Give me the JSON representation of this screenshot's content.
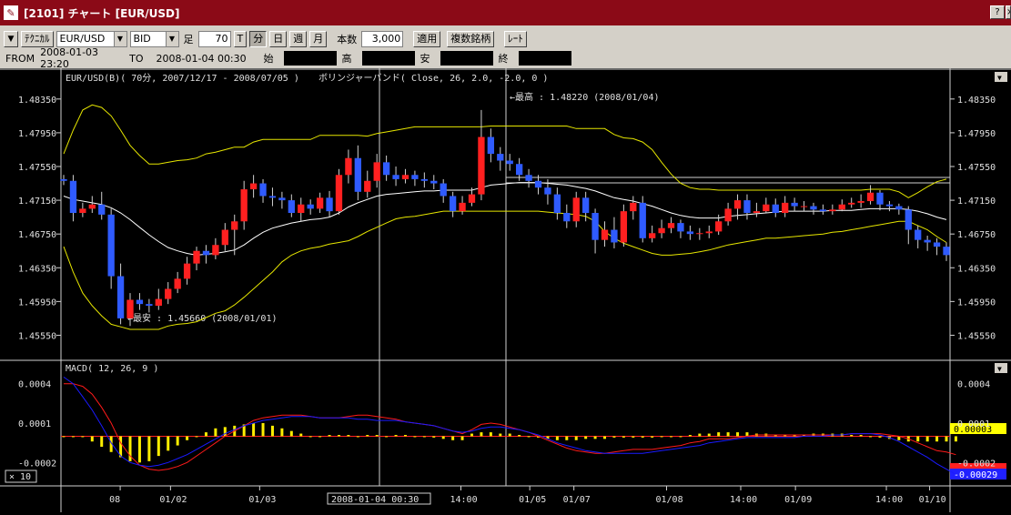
{
  "window": {
    "title": "[2101] チャート [EUR/USD]",
    "help_label": "?",
    "close_label": "×"
  },
  "toolbar": {
    "menu_arrow": "▼",
    "technical_label": "ﾃｸﾆｶﾙ",
    "pair_value": "EUR/USD",
    "side_value": "BID",
    "bar_label": "足",
    "bar_value": "70",
    "period_buttons": [
      "T",
      "分",
      "日",
      "週",
      "月"
    ],
    "count_label": "本数",
    "count_value": "3,000",
    "apply_label": "適用",
    "multi_label": "複数銘柄",
    "rate_label": "ﾚｰﾄ"
  },
  "info": {
    "from_label": "FROM",
    "from_value": "2008-01-03  23:20",
    "to_label": "TO",
    "to_value": "2008-01-04  00:30",
    "open_label": "始",
    "high_label": "高",
    "low_label": "安",
    "close_label": "終"
  },
  "colors": {
    "up": "#ff2020",
    "down": "#2f5bff",
    "band": "#e6e600",
    "mid": "#ffffff",
    "macd": "#1a1aff",
    "signal": "#ff1a1a",
    "hist": "#ffee00",
    "grid": "#d0d0d0"
  },
  "chart_data": [
    {
      "type": "candlestick",
      "title": "EUR/USD(B)( 70分, 2007/12/17 - 2008/07/05 )",
      "indicator": "ボリンジャーバンド( Close, 26, 2.0, -2.0, 0 )",
      "ylim": [
        1.4535,
        1.4865
      ],
      "yticks": [
        "1.48350",
        "1.47950",
        "1.47550",
        "1.47150",
        "1.46750",
        "1.46350",
        "1.45950",
        "1.45550"
      ],
      "xticks": [
        "08",
        "01/02",
        "01/03",
        "14:00",
        "01/05",
        "01/07",
        "01/08",
        "14:00",
        "01/09",
        "14:00",
        "01/10"
      ],
      "cursor_label": "2008-01-04  00:30",
      "high_annotation": "←最高 : 1.48220 (2008/01/04)",
      "low_annotation": "←最安 : 1.45660 (2008/01/01)",
      "candles": [
        [
          1.474,
          1.4738,
          1.4745,
          1.4733
        ],
        [
          1.4738,
          1.47,
          1.4745,
          1.469
        ],
        [
          1.47,
          1.4705,
          1.4712,
          1.4695
        ],
        [
          1.4705,
          1.471,
          1.472,
          1.47
        ],
        [
          1.471,
          1.4698,
          1.4725,
          1.4692
        ],
        [
          1.4698,
          1.4625,
          1.4705,
          1.461
        ],
        [
          1.4625,
          1.4575,
          1.464,
          1.4568
        ],
        [
          1.4575,
          1.4597,
          1.4605,
          1.4566
        ],
        [
          1.4597,
          1.4592,
          1.4605,
          1.4585
        ],
        [
          1.4592,
          1.459,
          1.4598,
          1.4582
        ],
        [
          1.459,
          1.4598,
          1.461,
          1.4585
        ],
        [
          1.4598,
          1.461,
          1.4618,
          1.4592
        ],
        [
          1.461,
          1.4622,
          1.463,
          1.4605
        ],
        [
          1.4622,
          1.464,
          1.4648,
          1.4615
        ],
        [
          1.464,
          1.4655,
          1.466,
          1.4632
        ],
        [
          1.4655,
          1.465,
          1.4662,
          1.464
        ],
        [
          1.465,
          1.4662,
          1.467,
          1.4645
        ],
        [
          1.4662,
          1.468,
          1.4688,
          1.4655
        ],
        [
          1.468,
          1.469,
          1.4698,
          1.465
        ],
        [
          1.469,
          1.4728,
          1.4738,
          1.468
        ],
        [
          1.4728,
          1.4735,
          1.4745,
          1.4718
        ],
        [
          1.4735,
          1.472,
          1.474,
          1.4712
        ],
        [
          1.472,
          1.4718,
          1.473,
          1.4708
        ],
        [
          1.4718,
          1.4715,
          1.4725,
          1.4705
        ],
        [
          1.4715,
          1.47,
          1.4722,
          1.4695
        ],
        [
          1.47,
          1.471,
          1.4718,
          1.469
        ],
        [
          1.471,
          1.4705,
          1.4716,
          1.4698
        ],
        [
          1.4705,
          1.4718,
          1.4724,
          1.47
        ],
        [
          1.4718,
          1.4702,
          1.4726,
          1.4695
        ],
        [
          1.4702,
          1.4745,
          1.4752,
          1.4698
        ],
        [
          1.4745,
          1.4765,
          1.4775,
          1.4735
        ],
        [
          1.4765,
          1.4725,
          1.478,
          1.4715
        ],
        [
          1.4725,
          1.4738,
          1.475,
          1.4718
        ],
        [
          1.4738,
          1.476,
          1.477,
          1.473
        ],
        [
          1.476,
          1.4745,
          1.4768,
          1.4738
        ],
        [
          1.4745,
          1.474,
          1.4755,
          1.4732
        ],
        [
          1.474,
          1.4745,
          1.4752,
          1.4735
        ],
        [
          1.4745,
          1.474,
          1.475,
          1.4732
        ],
        [
          1.474,
          1.4738,
          1.4748,
          1.473
        ],
        [
          1.4738,
          1.4735,
          1.4745,
          1.4728
        ],
        [
          1.4735,
          1.472,
          1.474,
          1.4712
        ],
        [
          1.472,
          1.4702,
          1.4725,
          1.4695
        ],
        [
          1.4702,
          1.4712,
          1.472,
          1.4698
        ],
        [
          1.4712,
          1.4722,
          1.473,
          1.4708
        ],
        [
          1.4722,
          1.479,
          1.4822,
          1.4715
        ],
        [
          1.479,
          1.477,
          1.48,
          1.476
        ],
        [
          1.477,
          1.4762,
          1.4778,
          1.475
        ],
        [
          1.4762,
          1.4758,
          1.477,
          1.475
        ],
        [
          1.4758,
          1.4745,
          1.4765,
          1.4738
        ],
        [
          1.4745,
          1.4738,
          1.4752,
          1.473
        ],
        [
          1.4738,
          1.473,
          1.4745,
          1.4722
        ],
        [
          1.473,
          1.4722,
          1.474,
          1.471
        ],
        [
          1.4722,
          1.47,
          1.473,
          1.4692
        ],
        [
          1.47,
          1.469,
          1.471,
          1.4682
        ],
        [
          1.469,
          1.4718,
          1.4725,
          1.4683
        ],
        [
          1.4718,
          1.47,
          1.4725,
          1.469
        ],
        [
          1.47,
          1.4668,
          1.4705,
          1.4652
        ],
        [
          1.4668,
          1.468,
          1.469,
          1.466
        ],
        [
          1.468,
          1.4665,
          1.4695,
          1.4658
        ],
        [
          1.4665,
          1.4702,
          1.471,
          1.466
        ],
        [
          1.4702,
          1.4712,
          1.472,
          1.4692
        ],
        [
          1.4712,
          1.467,
          1.472,
          1.4665
        ],
        [
          1.467,
          1.4676,
          1.4685,
          1.4665
        ],
        [
          1.4676,
          1.4682,
          1.4692,
          1.467
        ],
        [
          1.4682,
          1.4688,
          1.4695,
          1.4676
        ],
        [
          1.4688,
          1.4678,
          1.4692,
          1.467
        ],
        [
          1.4678,
          1.4675,
          1.4685,
          1.4668
        ],
        [
          1.4675,
          1.4676,
          1.4682,
          1.4668
        ],
        [
          1.4676,
          1.4678,
          1.4685,
          1.467
        ],
        [
          1.4678,
          1.469,
          1.4698,
          1.4674
        ],
        [
          1.469,
          1.4705,
          1.4712,
          1.4685
        ],
        [
          1.4705,
          1.4715,
          1.4722,
          1.4692
        ],
        [
          1.4715,
          1.47,
          1.4722,
          1.4692
        ],
        [
          1.47,
          1.4702,
          1.4712,
          1.4695
        ],
        [
          1.4702,
          1.471,
          1.4718,
          1.47
        ],
        [
          1.471,
          1.47,
          1.4717,
          1.4695
        ],
        [
          1.47,
          1.4712,
          1.472,
          1.4695
        ],
        [
          1.4712,
          1.4708,
          1.4718,
          1.4702
        ],
        [
          1.4708,
          1.4708,
          1.4714,
          1.4702
        ],
        [
          1.4708,
          1.4704,
          1.4712,
          1.4698
        ],
        [
          1.4704,
          1.4702,
          1.471,
          1.4698
        ],
        [
          1.4702,
          1.4704,
          1.471,
          1.4698
        ],
        [
          1.4704,
          1.471,
          1.4716,
          1.4702
        ],
        [
          1.471,
          1.4712,
          1.4718,
          1.4706
        ],
        [
          1.4712,
          1.4714,
          1.4722,
          1.4706
        ],
        [
          1.4714,
          1.4724,
          1.4733,
          1.471
        ],
        [
          1.4724,
          1.471,
          1.4727,
          1.4703
        ],
        [
          1.471,
          1.4708,
          1.4714,
          1.4702
        ],
        [
          1.4708,
          1.4704,
          1.4711,
          1.4698
        ],
        [
          1.4704,
          1.468,
          1.4708,
          1.4663
        ],
        [
          1.468,
          1.4668,
          1.4685,
          1.4658
        ],
        [
          1.4668,
          1.4665,
          1.4673,
          1.4655
        ],
        [
          1.4665,
          1.466,
          1.467,
          1.465
        ],
        [
          1.466,
          1.465,
          1.4665,
          1.4643
        ]
      ],
      "bb_upper": [
        1.477,
        1.4798,
        1.4822,
        1.4828,
        1.4825,
        1.4815,
        1.4798,
        1.478,
        1.4768,
        1.4758,
        1.4758,
        1.476,
        1.4762,
        1.4763,
        1.4765,
        1.477,
        1.4772,
        1.4775,
        1.4778,
        1.4778,
        1.4784,
        1.4787,
        1.4787,
        1.4787,
        1.4787,
        1.4787,
        1.4787,
        1.4792,
        1.4792,
        1.4792,
        1.4792,
        1.4792,
        1.4791,
        1.4794,
        1.4796,
        1.4798,
        1.48,
        1.4802,
        1.4802,
        1.4802,
        1.4802,
        1.4802,
        1.4802,
        1.4802,
        1.4802,
        1.4803,
        1.4803,
        1.4803,
        1.4803,
        1.4803,
        1.4803,
        1.4803,
        1.4803,
        1.4803,
        1.48,
        1.48,
        1.48,
        1.48,
        1.4793,
        1.4789,
        1.4788,
        1.4784,
        1.4775,
        1.476,
        1.4746,
        1.4735,
        1.473,
        1.4728,
        1.4728,
        1.4727,
        1.4727,
        1.4727,
        1.4727,
        1.4727,
        1.4727,
        1.4727,
        1.4727,
        1.4727,
        1.4727,
        1.4727,
        1.4727,
        1.4727,
        1.4727,
        1.4727,
        1.4727,
        1.4728,
        1.4728,
        1.4728,
        1.4725,
        1.4718,
        1.4724,
        1.4731,
        1.4737,
        1.474
      ],
      "bb_mid": [
        1.472,
        1.4716,
        1.4714,
        1.4712,
        1.471,
        1.4706,
        1.47,
        1.4692,
        1.4683,
        1.4674,
        1.4666,
        1.4659,
        1.4655,
        1.4652,
        1.465,
        1.4651,
        1.4652,
        1.4654,
        1.4656,
        1.4662,
        1.467,
        1.4677,
        1.4682,
        1.4685,
        1.4688,
        1.469,
        1.4692,
        1.4693,
        1.4695,
        1.47,
        1.4707,
        1.4712,
        1.4716,
        1.472,
        1.4722,
        1.4723,
        1.4724,
        1.4725,
        1.4726,
        1.4726,
        1.4727,
        1.4727,
        1.4727,
        1.4727,
        1.473,
        1.4733,
        1.4734,
        1.4735,
        1.4736,
        1.4736,
        1.4736,
        1.4735,
        1.4734,
        1.4733,
        1.4731,
        1.4729,
        1.4726,
        1.4722,
        1.4718,
        1.4716,
        1.4714,
        1.4711,
        1.4708,
        1.4704,
        1.47,
        1.4697,
        1.4695,
        1.4694,
        1.4694,
        1.4694,
        1.4696,
        1.4697,
        1.4698,
        1.4699,
        1.47,
        1.4701,
        1.4702,
        1.4702,
        1.4702,
        1.4702,
        1.4702,
        1.4703,
        1.4703,
        1.4703,
        1.4704,
        1.4705,
        1.4705,
        1.4705,
        1.4705,
        1.4704,
        1.4702,
        1.4699,
        1.4695,
        1.4692
      ],
      "bb_lower": [
        1.466,
        1.463,
        1.4605,
        1.459,
        1.4578,
        1.4568,
        1.4565,
        1.4562,
        1.4562,
        1.4562,
        1.4562,
        1.4566,
        1.4568,
        1.4569,
        1.4571,
        1.4576,
        1.4581,
        1.4584,
        1.4591,
        1.46,
        1.461,
        1.462,
        1.463,
        1.4642,
        1.465,
        1.4655,
        1.4658,
        1.466,
        1.4663,
        1.4665,
        1.4667,
        1.4672,
        1.4678,
        1.4683,
        1.4688,
        1.4693,
        1.4695,
        1.4696,
        1.4698,
        1.47,
        1.4702,
        1.4702,
        1.4702,
        1.4702,
        1.4702,
        1.4702,
        1.4702,
        1.4702,
        1.4702,
        1.4702,
        1.4702,
        1.4701,
        1.47,
        1.4699,
        1.4698,
        1.4696,
        1.469,
        1.4678,
        1.467,
        1.4664,
        1.466,
        1.4656,
        1.4652,
        1.465,
        1.465,
        1.4651,
        1.4652,
        1.4654,
        1.4656,
        1.4659,
        1.4662,
        1.4664,
        1.4666,
        1.4668,
        1.467,
        1.467,
        1.4671,
        1.4672,
        1.4673,
        1.4674,
        1.4675,
        1.4677,
        1.4678,
        1.468,
        1.4682,
        1.4684,
        1.4686,
        1.4688,
        1.469,
        1.469,
        1.4685,
        1.468,
        1.4672,
        1.4665
      ]
    },
    {
      "type": "macd",
      "title": "MACD( 12, 26, 9 )",
      "ylim": [
        -0.00035,
        0.00055
      ],
      "yticks": [
        "0.0004",
        "0.0001",
        "-0.0002"
      ],
      "zoom_label": "× 10",
      "last_signal_label": "0.00003",
      "last_macd_label": "-0.00029",
      "macd": [
        0.00045,
        0.0004,
        0.0003,
        0.0002,
        8e-05,
        -5e-05,
        -0.00015,
        -0.0002,
        -0.00022,
        -0.00023,
        -0.00022,
        -0.0002,
        -0.00017,
        -0.00014,
        -0.0001,
        -6e-05,
        -2e-05,
        2e-05,
        5e-05,
        8e-05,
        0.0001,
        0.00012,
        0.00013,
        0.00014,
        0.00015,
        0.00015,
        0.00015,
        0.00014,
        0.00014,
        0.00014,
        0.00014,
        0.00013,
        0.00013,
        0.00012,
        0.00012,
        0.00012,
        0.00011,
        0.0001,
        9e-05,
        8e-05,
        6e-05,
        4e-05,
        3e-05,
        4e-05,
        6e-05,
        7e-05,
        7e-05,
        6e-05,
        5e-05,
        3e-05,
        1e-05,
        -2e-05,
        -5e-05,
        -7e-05,
        -9e-05,
        -0.00011,
        -0.00012,
        -0.00013,
        -0.00013,
        -0.00013,
        -0.00013,
        -0.00013,
        -0.00012,
        -0.00011,
        -0.0001,
        -9e-05,
        -8e-05,
        -7e-05,
        -5e-05,
        -4e-05,
        -3e-05,
        -2e-05,
        -1e-05,
        -1e-05,
        -1e-05,
        -1e-05,
        -1e-05,
        -1e-05,
        0.0,
        0.0,
        0.0,
        1e-05,
        1e-05,
        2e-05,
        2e-05,
        2e-05,
        1e-05,
        -1e-05,
        -4e-05,
        -8e-05,
        -0.00012,
        -0.00016,
        -0.00021,
        -0.00025,
        -0.00029
      ],
      "signal": [
        0.0004,
        0.0004,
        0.00038,
        0.00032,
        0.00022,
        0.0001,
        -5e-05,
        -0.00015,
        -0.00022,
        -0.00025,
        -0.00026,
        -0.00025,
        -0.00023,
        -0.0002,
        -0.00015,
        -0.0001,
        -5e-05,
        0.0,
        4e-05,
        8e-05,
        0.00012,
        0.00014,
        0.00015,
        0.00016,
        0.00016,
        0.00016,
        0.00015,
        0.00014,
        0.00014,
        0.00014,
        0.00015,
        0.00016,
        0.00016,
        0.00015,
        0.00014,
        0.00013,
        0.00011,
        0.0001,
        9e-05,
        8e-05,
        6e-05,
        4e-05,
        2e-05,
        5e-05,
        9e-05,
        0.0001,
        9e-05,
        7e-05,
        5e-05,
        3e-05,
        0.0,
        -3e-05,
        -6e-05,
        -9e-05,
        -0.00011,
        -0.00012,
        -0.00013,
        -0.00013,
        -0.00012,
        -0.00011,
        -0.0001,
        -0.0001,
        -0.0001,
        -9e-05,
        -8e-05,
        -7e-05,
        -5e-05,
        -4e-05,
        -2e-05,
        -2e-05,
        -2e-05,
        -1e-05,
        0.0,
        1e-05,
        1e-05,
        1e-05,
        1e-05,
        1e-05,
        1e-05,
        1e-05,
        1e-05,
        1e-05,
        1e-05,
        2e-05,
        2e-05,
        2e-05,
        2e-05,
        1e-05,
        0.0,
        -2e-05,
        -5e-05,
        -8e-05,
        -0.00011,
        -0.00012,
        -0.00014
      ],
      "hist": [
        0.0,
        0.0,
        0.0,
        -4e-05,
        -8e-05,
        -0.00012,
        -0.00016,
        -0.00019,
        -0.0002,
        -0.00019,
        -0.00015,
        -0.00011,
        -7e-05,
        -3e-05,
        0.0,
        3e-05,
        6e-05,
        7e-05,
        8e-05,
        9e-05,
        0.0001,
        0.0001,
        8e-05,
        6e-05,
        4e-05,
        2e-05,
        0.0,
        0.0,
        1e-05,
        1e-05,
        1e-05,
        0.0,
        1e-05,
        1e-05,
        0.0,
        1e-05,
        1e-05,
        0.0,
        0.0,
        -1e-05,
        -2e-05,
        -3e-05,
        -3e-05,
        2e-05,
        3e-05,
        3e-05,
        2e-05,
        2e-05,
        1e-05,
        0.0,
        -1e-05,
        -2e-05,
        -3e-05,
        -3e-05,
        -3e-05,
        -2e-05,
        -2e-05,
        -2e-05,
        -1e-05,
        -1e-05,
        -1e-05,
        -1e-05,
        -1e-05,
        0.0,
        0.0,
        0.0,
        1e-05,
        2e-05,
        2e-05,
        3e-05,
        3e-05,
        3e-05,
        3e-05,
        2e-05,
        2e-05,
        1e-05,
        1e-05,
        1e-05,
        1e-05,
        2e-05,
        2e-05,
        2e-05,
        2e-05,
        1e-05,
        1e-05,
        0.0,
        -1e-05,
        -2e-05,
        -3e-05,
        -4e-05,
        -4e-05,
        -4e-05,
        -4e-05,
        -4e-05,
        -4e-05
      ]
    }
  ]
}
